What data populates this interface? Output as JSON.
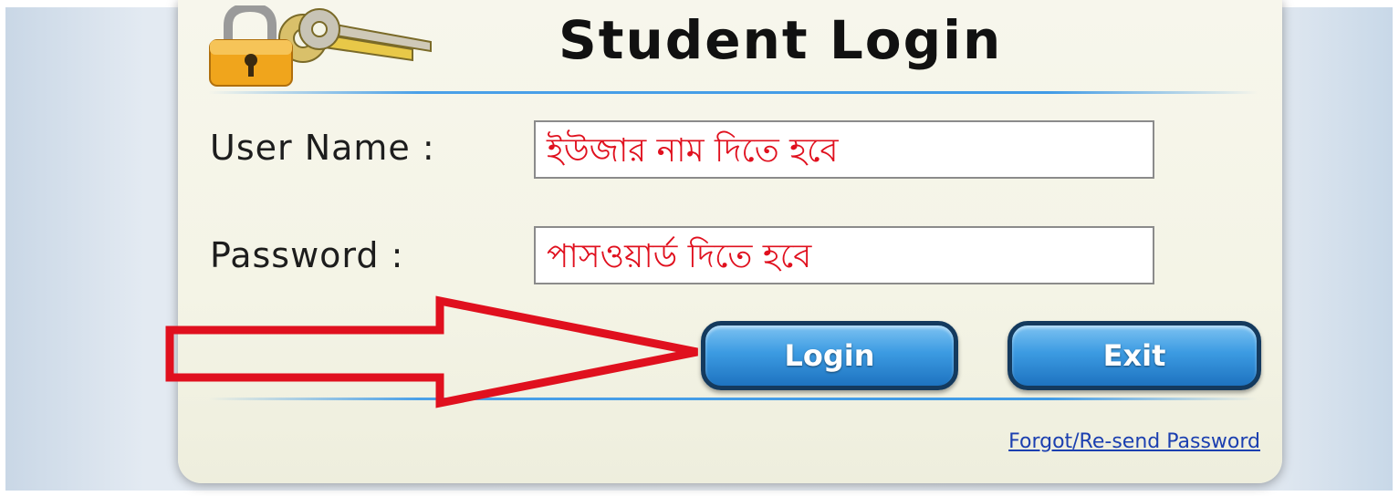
{
  "window": {
    "title": "Student Login"
  },
  "form": {
    "username_label": "User Name :",
    "username_placeholder": "ইউজার নাম দিতে হবে",
    "password_label": "Password :",
    "password_placeholder": "পাসওয়ার্ড দিতে হবে"
  },
  "buttons": {
    "login_label": "Login",
    "exit_label": "Exit"
  },
  "links": {
    "forgot_label": "Forgot/Re-send Password"
  },
  "icons": {
    "header": "lock-with-keys-icon",
    "annotation": "red-arrow-icon"
  },
  "colors": {
    "accent": "#3c9be2",
    "hint_text": "#e0101e",
    "annotation": "#e0101e",
    "link": "#1b3fb0"
  }
}
